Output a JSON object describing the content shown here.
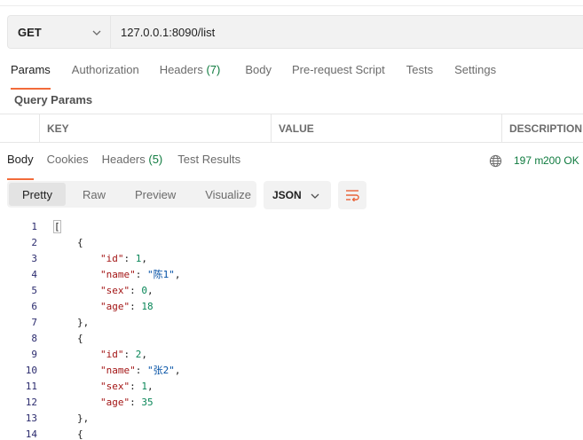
{
  "request": {
    "method": "GET",
    "url": "127.0.0.1:8090/list"
  },
  "request_tabs": [
    {
      "label": "Params",
      "count": ""
    },
    {
      "label": "Authorization",
      "count": ""
    },
    {
      "label": "Headers",
      "count": "(7)"
    },
    {
      "label": "Body",
      "count": ""
    },
    {
      "label": "Pre-request Script",
      "count": ""
    },
    {
      "label": "Tests",
      "count": ""
    },
    {
      "label": "Settings",
      "count": ""
    }
  ],
  "query_params_label": "Query Params",
  "params_table": {
    "columns": [
      "KEY",
      "VALUE",
      "DESCRIPTION"
    ]
  },
  "response_tabs": [
    {
      "label": "Body",
      "count": ""
    },
    {
      "label": "Cookies",
      "count": ""
    },
    {
      "label": "Headers",
      "count": "(5)"
    },
    {
      "label": "Test Results",
      "count": ""
    }
  ],
  "response_status": {
    "code": "200 OK",
    "time": "197 m"
  },
  "format_tabs": [
    "Pretty",
    "Raw",
    "Preview",
    "Visualize"
  ],
  "language": "JSON",
  "icons": {
    "globe": "globe-icon",
    "wrap": "wrap-lines-icon",
    "dropdown": "chevron-down-icon"
  },
  "colors": {
    "accent": "#f26b3a",
    "status": "#0f7b3f"
  },
  "code_lines": [
    {
      "n": "1",
      "indent": 0,
      "tokens": [
        [
          "p",
          "["
        ]
      ]
    },
    {
      "n": "2",
      "indent": 1,
      "tokens": [
        [
          "p",
          "{"
        ]
      ]
    },
    {
      "n": "3",
      "indent": 2,
      "tokens": [
        [
          "k",
          "\"id\""
        ],
        [
          "p",
          ": "
        ],
        [
          "n",
          "1"
        ],
        [
          "p",
          ","
        ]
      ]
    },
    {
      "n": "4",
      "indent": 2,
      "tokens": [
        [
          "k",
          "\"name\""
        ],
        [
          "p",
          ": "
        ],
        [
          "s",
          "\"陈1\""
        ],
        [
          "p",
          ","
        ]
      ]
    },
    {
      "n": "5",
      "indent": 2,
      "tokens": [
        [
          "k",
          "\"sex\""
        ],
        [
          "p",
          ": "
        ],
        [
          "n",
          "0"
        ],
        [
          "p",
          ","
        ]
      ]
    },
    {
      "n": "6",
      "indent": 2,
      "tokens": [
        [
          "k",
          "\"age\""
        ],
        [
          "p",
          ": "
        ],
        [
          "n",
          "18"
        ]
      ]
    },
    {
      "n": "7",
      "indent": 1,
      "tokens": [
        [
          "p",
          "},"
        ]
      ]
    },
    {
      "n": "8",
      "indent": 1,
      "tokens": [
        [
          "p",
          "{"
        ]
      ]
    },
    {
      "n": "9",
      "indent": 2,
      "tokens": [
        [
          "k",
          "\"id\""
        ],
        [
          "p",
          ": "
        ],
        [
          "n",
          "2"
        ],
        [
          "p",
          ","
        ]
      ]
    },
    {
      "n": "10",
      "indent": 2,
      "tokens": [
        [
          "k",
          "\"name\""
        ],
        [
          "p",
          ": "
        ],
        [
          "s",
          "\"张2\""
        ],
        [
          "p",
          ","
        ]
      ]
    },
    {
      "n": "11",
      "indent": 2,
      "tokens": [
        [
          "k",
          "\"sex\""
        ],
        [
          "p",
          ": "
        ],
        [
          "n",
          "1"
        ],
        [
          "p",
          ","
        ]
      ]
    },
    {
      "n": "12",
      "indent": 2,
      "tokens": [
        [
          "k",
          "\"age\""
        ],
        [
          "p",
          ": "
        ],
        [
          "n",
          "35"
        ]
      ]
    },
    {
      "n": "13",
      "indent": 1,
      "tokens": [
        [
          "p",
          "},"
        ]
      ]
    },
    {
      "n": "14",
      "indent": 1,
      "tokens": [
        [
          "p",
          "{"
        ]
      ]
    }
  ]
}
